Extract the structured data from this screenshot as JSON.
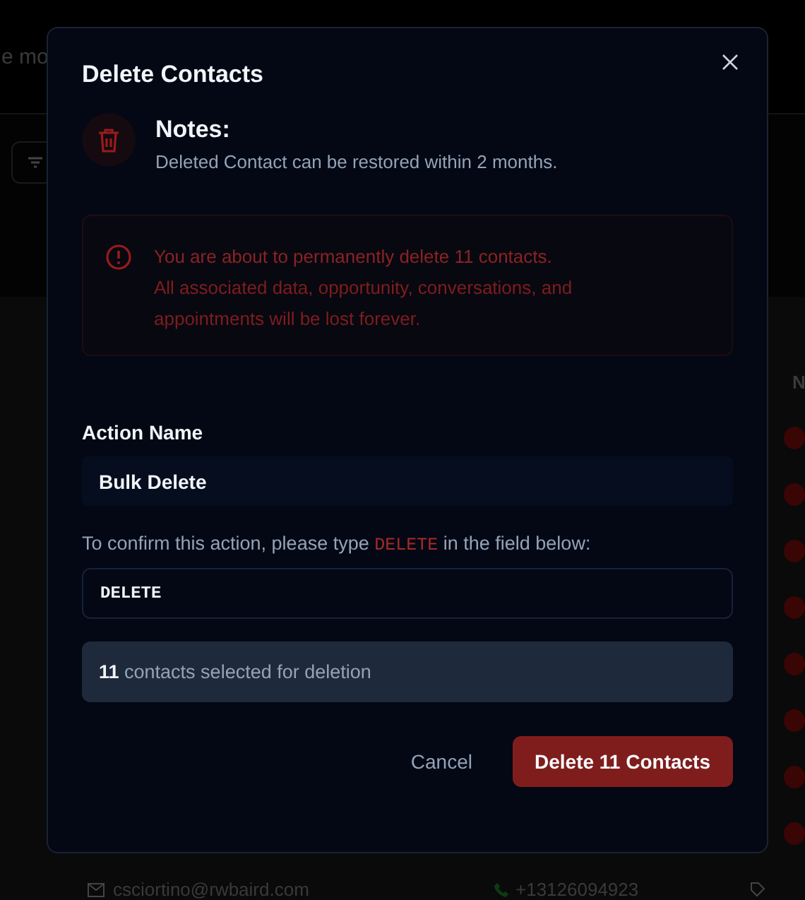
{
  "background": {
    "header_text": "e mo",
    "column_heading": "N",
    "contact_row": {
      "email": "csciortino@rwbaird.com",
      "phone": "+13126094923"
    }
  },
  "dialog": {
    "title": "Delete Contacts",
    "notes": {
      "title": "Notes:",
      "text": "Deleted Contact can be restored within 2 months."
    },
    "alert": {
      "lines": [
        "You are about to permanently delete 11 contacts.",
        "All associated data, opportunity, conversations, and appointments will be lost forever."
      ]
    },
    "action_name": {
      "label": "Action Name",
      "value": "Bulk Delete"
    },
    "confirm": {
      "text": "To confirm this action, please type **DELETE** in the field below:",
      "value": "DELETE"
    },
    "selection_summary": "**11** contacts selected for deletion",
    "buttons": {
      "cancel": "Cancel",
      "delete": "Delete 11 Contacts"
    }
  }
}
